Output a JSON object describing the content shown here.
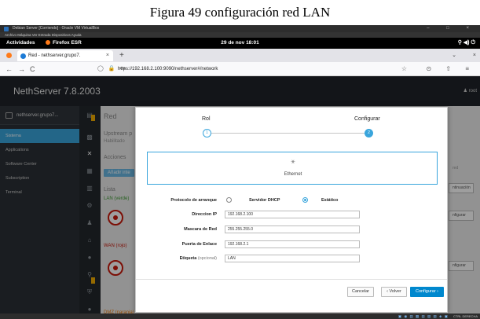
{
  "caption": "Figura 49 configuración red LAN",
  "vbox": {
    "title": "Debian Server [Corriendo] - Oracle VM VirtualBox",
    "menu": "Archivo  Máquina  Ver  Entrada  Dispositivos  Ayuda",
    "window_controls": "–  □  ×",
    "tray_text": "CTRL DERECHA"
  },
  "gnome": {
    "activities": "Actividades",
    "app": "Firefox ESR",
    "clock": "29 de nov  18:01",
    "tray": "⚲ ◀) ⏻"
  },
  "firefox": {
    "tab_title": "Red - nethserver.grupo7.",
    "tab_close": "×",
    "new_tab": "+",
    "url": "https://192.168.2.100:9090/nethserver#/network",
    "back": "←",
    "forward": "→",
    "reload": "C",
    "url_icons": "◯ 🔒 ⊶",
    "star": "☆",
    "right_icons": "⊙ ⇧ ≡",
    "tab_list": "⌄",
    "tab_x": "×"
  },
  "neth": {
    "brand": "NethServer 7.8.2003",
    "user": "♟ root",
    "host": "nethserver.grupo7...",
    "sidebar": [
      {
        "label": "Sistema",
        "active": true
      },
      {
        "label": "Applications",
        "active": false
      },
      {
        "label": "Software Center",
        "active": false
      },
      {
        "label": "Subscription",
        "active": false
      },
      {
        "label": "Terminal",
        "active": false
      }
    ],
    "background": {
      "page_title": "Red",
      "upstream": "Upstream p",
      "habilitado": "Habilitado",
      "acciones": "Acciones",
      "add_button": "Añadir inte",
      "lista": "Lista",
      "lan_label": "LAN (verde)",
      "wan_label": "WAN (rojo)",
      "dmz_label": "DMZ (naranja)",
      "dropdown1": "ntinuación",
      "dropdown2": "nfigurar",
      "dropdown3": "nfigurar",
      "ip_hint": "red"
    }
  },
  "modal": {
    "step1_label": "Rol",
    "step2_label": "Configurar",
    "step1_num": "1",
    "step2_num": "2",
    "interface_icon": "⚹",
    "interface_label": "Ethernet",
    "boot_protocol_label": "Protocolo de arranque",
    "option_dhcp": "Servidor DHCP",
    "option_static": "Estático",
    "ip_label": "Direccion IP",
    "ip_value": "192.168.2.100",
    "mask_label": "Mascara de Red",
    "mask_value": "255.255.255.0",
    "gateway_label": "Puerta de Enlace",
    "gateway_value": "192.168.2.1",
    "tag_label": "Etiqueta",
    "tag_optional": "(opcional)",
    "tag_value": "LAN",
    "cancel": "Cancelar",
    "back": "‹ Volver",
    "configure": "Configurar ›"
  },
  "colors": {
    "accent": "#39a5dc",
    "primary_button": "#0088ce",
    "sidebar_bg": "#2b3036",
    "header_bg": "#1f2329"
  }
}
